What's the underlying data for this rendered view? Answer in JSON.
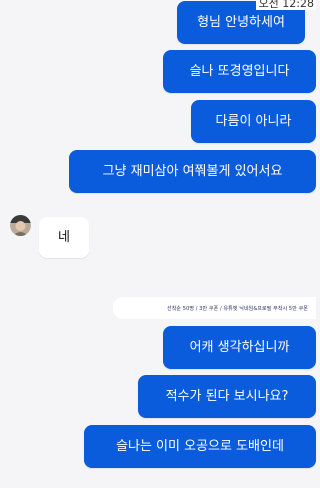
{
  "status": {
    "time": "오전 12:28"
  },
  "messages": [
    {
      "side": "me",
      "text": "형님 안녕하세여"
    },
    {
      "side": "me",
      "text": "슬나 또경영입니다"
    },
    {
      "side": "me",
      "text": "다름이 아니라"
    },
    {
      "side": "me",
      "text": "그냥 재미삼아 여쭤볼게 있어서요"
    },
    {
      "side": "other",
      "text": "네"
    },
    {
      "side": "me",
      "text": "어캐 생각하십니까"
    },
    {
      "side": "me",
      "text": "적수가 된다 보시나요?"
    },
    {
      "side": "me",
      "text": "슬나는 이미 오공으로 도배인데"
    }
  ],
  "banner": {
    "text": "선착순 50명 / 3만 쿠폰 / 유튜벳 닉네임&프로필 부착시 5만 쿠폰"
  },
  "colors": {
    "my_bubble": "#0a5cdc",
    "other_bubble": "#ffffff",
    "background": "#f5f5f7"
  },
  "icons": {
    "avatar": "user-avatar-icon"
  }
}
